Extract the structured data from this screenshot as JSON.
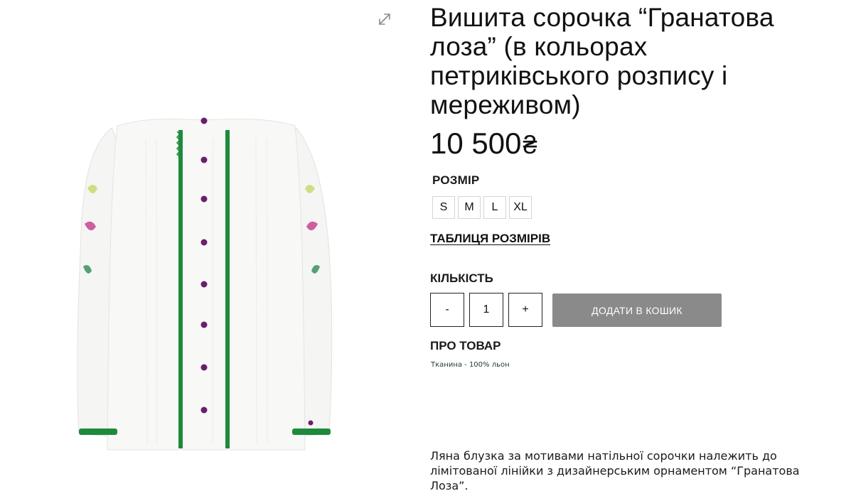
{
  "product": {
    "title": "Вишита сорочка “Гранатова лоза” (в кольорах петриківського розпису і мереживом)",
    "price": "10 500",
    "currency": "₴",
    "image_icon": "embroidered-shirt-image"
  },
  "size": {
    "label": "РОЗМІР",
    "options": [
      "S",
      "M",
      "L",
      "XL"
    ],
    "table_link": "ТАБЛИЦЯ РОЗМІРІВ"
  },
  "quantity": {
    "label": "КІЛЬКІСТЬ",
    "minus": "-",
    "value": "1",
    "plus": "+"
  },
  "cart": {
    "add_label": "ДОДАТИ В КОШИК"
  },
  "about": {
    "label": "ПРО ТОВАР",
    "fabric": "Тканина - 100% льон",
    "description": "Ляна блузка за мотивами натільної сорочки належить до лімітованої лінійки з дизайнерським орнаментом “Гранатова Лоза”."
  },
  "colors": {
    "button_gray": "#8a8a8a",
    "green_trim": "#1e8a3c",
    "purple_button": "#6a1e6e"
  },
  "icons": {
    "expand": "expand-icon"
  }
}
